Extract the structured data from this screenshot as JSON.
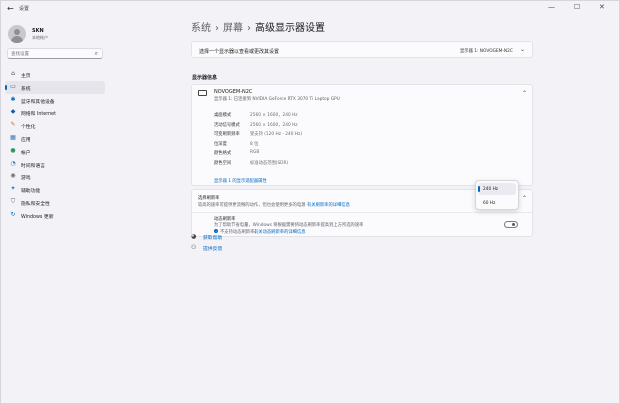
{
  "window": {
    "app_title": "设置",
    "back_glyph": "←",
    "min_glyph": "—",
    "max_glyph": "☐",
    "close_glyph": "✕"
  },
  "profile": {
    "name": "SKN",
    "type": "本地帐户"
  },
  "search": {
    "placeholder": "查找设置",
    "icon": "search-icon"
  },
  "sidebar": {
    "items": [
      {
        "label": "主页",
        "icon": "home-icon",
        "glyph": "⌂",
        "color": "#444444"
      },
      {
        "label": "系统",
        "icon": "system-icon",
        "glyph": "▭",
        "color": "#0067c0"
      },
      {
        "label": "蓝牙和其他设备",
        "icon": "bluetooth-icon",
        "glyph": "✱",
        "color": "#0067c0"
      },
      {
        "label": "网络和 Internet",
        "icon": "network-icon",
        "glyph": "◆",
        "color": "#0a5fb0"
      },
      {
        "label": "个性化",
        "icon": "personalization-icon",
        "glyph": "✎",
        "color": "#d06a2b"
      },
      {
        "label": "应用",
        "icon": "apps-icon",
        "glyph": "▦",
        "color": "#3a6fb8"
      },
      {
        "label": "帐户",
        "icon": "accounts-icon",
        "glyph": "●",
        "color": "#2f9b63"
      },
      {
        "label": "时间和语言",
        "icon": "time-language-icon",
        "glyph": "◔",
        "color": "#1f7bd0"
      },
      {
        "label": "游戏",
        "icon": "gaming-icon",
        "glyph": "◉",
        "color": "#6a6a72"
      },
      {
        "label": "辅助功能",
        "icon": "accessibility-icon",
        "glyph": "✦",
        "color": "#2a6fd0"
      },
      {
        "label": "隐私和安全性",
        "icon": "privacy-icon",
        "glyph": "⛉",
        "color": "#5a6a7a"
      },
      {
        "label": "Windows 更新",
        "icon": "windows-update-icon",
        "glyph": "↻",
        "color": "#0067c0"
      }
    ],
    "active_index": 1
  },
  "breadcrumb": {
    "part1": "系统",
    "part2": "屏幕",
    "current": "高级显示器设置",
    "sep": "›"
  },
  "select_display": {
    "label": "选择一个显示器以查看或更改其设置",
    "value": "显示器 1: NOVOGEM-N2C"
  },
  "section_title": "显示器信息",
  "display_info": {
    "name": "NOVOGEM-N2C",
    "subtitle": "显示器 1: 已连接到 NVIDIA GeForce RTX 3070 Ti Laptop GPU",
    "specs": [
      {
        "key": "桌面模式",
        "value": "2560 × 1600，240 Hz"
      },
      {
        "key": "活动信号模式",
        "value": "2560 × 1600，240 Hz"
      },
      {
        "key": "可变刷新频率",
        "value": "受支持 (120 Hz - 240 Hz)"
      },
      {
        "key": "位深度",
        "value": "8 位"
      },
      {
        "key": "颜色格式",
        "value": "RGB"
      },
      {
        "key": "颜色空间",
        "value": "标准动态范围(SDR)"
      }
    ],
    "adapter_link": "显示器 1 的显示适配器属性"
  },
  "refresh_rate": {
    "title": "选择刷新率",
    "desc": "较高的速率可提供更流畅的动作，但也会使用更多的电源",
    "more_link": "有关刷新率的详细信息",
    "options": [
      "240 Hz",
      "60 Hz"
    ],
    "selected": "240 Hz"
  },
  "dynamic_refresh": {
    "title": "动态刷新率",
    "desc": "为了帮助节省电量，Windows 将根据需要将动态刷新率提高到上方所选的速率",
    "info_text": "不支持动态刷新率。",
    "info_link": "有关动态刷新率的详细信息",
    "info_icon": "info-icon",
    "info_glyph": "i"
  },
  "help": {
    "get_help": "获取帮助",
    "feedback": "提供反馈",
    "help_icon": "help-icon",
    "feedback_icon": "feedback-icon"
  },
  "colors": {
    "accent": "#0067c0",
    "background": "#f3f2f7",
    "card": "#fbfbfd"
  }
}
